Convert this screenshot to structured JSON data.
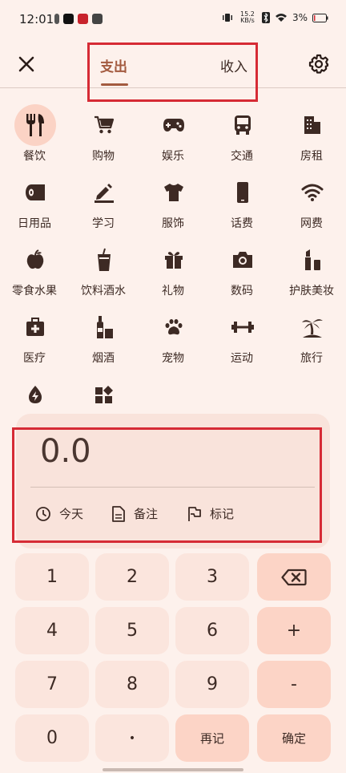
{
  "status_bar": {
    "time": "12:01",
    "net_speed": "15.2 KB/s",
    "battery": "3%"
  },
  "header": {
    "tabs": [
      "支出",
      "收入"
    ]
  },
  "categories": [
    {
      "label": "餐饮",
      "icon": "fork-knife-icon"
    },
    {
      "label": "购物",
      "icon": "cart-icon"
    },
    {
      "label": "娱乐",
      "icon": "gamepad-icon"
    },
    {
      "label": "交通",
      "icon": "bus-icon"
    },
    {
      "label": "房租",
      "icon": "building-icon"
    },
    {
      "label": "日用品",
      "icon": "tissue-roll-icon"
    },
    {
      "label": "学习",
      "icon": "pencil-icon"
    },
    {
      "label": "服饰",
      "icon": "shirt-icon"
    },
    {
      "label": "话费",
      "icon": "phone-icon"
    },
    {
      "label": "网费",
      "icon": "wifi-icon"
    },
    {
      "label": "零食水果",
      "icon": "apple-icon"
    },
    {
      "label": "饮料酒水",
      "icon": "drink-cup-icon"
    },
    {
      "label": "礼物",
      "icon": "gift-icon"
    },
    {
      "label": "数码",
      "icon": "camera-icon"
    },
    {
      "label": "护肤美妆",
      "icon": "lipstick-icon"
    },
    {
      "label": "医疗",
      "icon": "medical-kit-icon"
    },
    {
      "label": "烟酒",
      "icon": "bottle-icon"
    },
    {
      "label": "宠物",
      "icon": "paw-icon"
    },
    {
      "label": "运动",
      "icon": "dumbbell-icon"
    },
    {
      "label": "旅行",
      "icon": "palm-tree-icon"
    },
    {
      "label": "",
      "icon": "bolt-icon"
    },
    {
      "label": "",
      "icon": "widgets-icon"
    }
  ],
  "amount": {
    "value": "0.0"
  },
  "options": {
    "date": "今天",
    "note": "备注",
    "tag": "标记"
  },
  "keypad": {
    "k1": "1",
    "k2": "2",
    "k3": "3",
    "k4": "4",
    "k5": "5",
    "k6": "6",
    "plus": "+",
    "k7": "7",
    "k8": "8",
    "k9": "9",
    "minus": "-",
    "k0": "0",
    "dot": "•",
    "again": "再记",
    "confirm": "确定"
  },
  "colors": {
    "accent": "#a35a3f",
    "background": "#fdf1ec",
    "panel": "#f9e3db",
    "highlight": "#d62b35"
  }
}
